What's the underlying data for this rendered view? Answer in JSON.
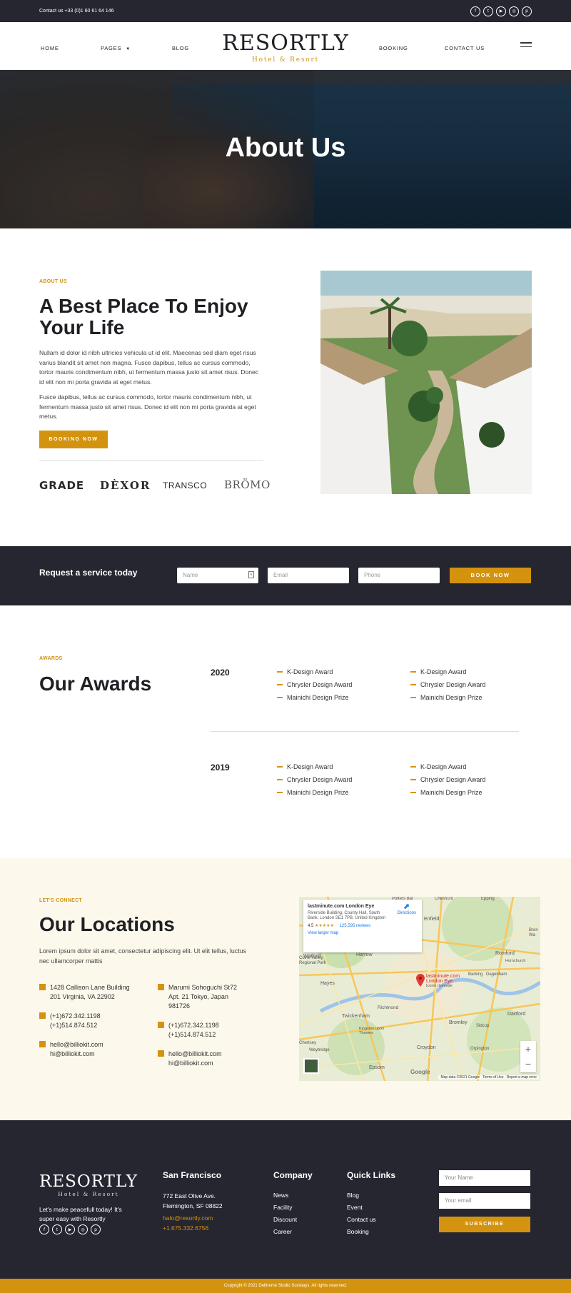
{
  "topbar": {
    "contact": "Contact us +33 (0)1 60 61 64 146",
    "social_icons": [
      "facebook-icon",
      "twitter-icon",
      "youtube-icon",
      "instagram-icon",
      "pinterest-icon"
    ]
  },
  "nav": {
    "home": "HOME",
    "pages": "PAGES",
    "blog": "BLOG",
    "booking": "BOOKING",
    "contact": "CONTACT US",
    "brand": "RESORTLY",
    "brand_sub": "Hotel & Resort"
  },
  "hero": {
    "title": "About Us"
  },
  "about": {
    "eyebrow": "ABOUT US",
    "title": "A Best Place To Enjoy Your Life",
    "para1": "Nullam id dolor id nibh ultricies vehicula ut id elit. Maecenas sed diam eget risus varius blandit sit amet non magna. Fusce dapibus, tellus ac cursus commodo, tortor mauris condimentum nibh, ut fermentum massa justo sit amet risus. Donec id elit non mi porta gravida at eget metus.",
    "para2": "Fusce dapibus, tellus ac cursus commodo, tortor mauris condimentum nibh, ut fermentum massa justo sit amet risus. Donec id elit non mi porta gravida at eget metus.",
    "button": "BOOKING NOW",
    "partners": [
      "GRADE",
      "DÈXOR",
      "TRANSCO",
      "BRÖMO"
    ]
  },
  "request": {
    "label": "Request a service today",
    "name_placeholder": "Name",
    "email_placeholder": "Email",
    "phone_placeholder": "Phone",
    "button": "BOOK NOW"
  },
  "awards": {
    "eyebrow": "AWARDS",
    "title": "Our Awards",
    "years": [
      {
        "year": "2020",
        "col1": [
          "K-Design Award",
          "Chrysler Design Award",
          "Mainichi Design Prize"
        ],
        "col2": [
          "K-Design Award",
          "Chrysler Design Award",
          "Mainichi Design Prize"
        ]
      },
      {
        "year": "2019",
        "col1": [
          "K-Design Award",
          "Chrysler Design Award",
          "Mainichi Design Prize"
        ],
        "col2": [
          "K-Design Award",
          "Chrysler Design Award",
          "Mainichi Design Prize"
        ]
      }
    ]
  },
  "locations": {
    "eyebrow": "LET'S CONNECT",
    "title": "Our Locations",
    "desc": "Lorem ipsum dolor sit amet, consectetur adipiscing elit. Ut elit tellus, luctus nec ullamcorper mattis",
    "left": {
      "address1": "1428 Callison Lane Building",
      "address2": "201 Virginia, VA 22902",
      "phone1": "(+1)672.342.1198",
      "phone2": "(+1)514.874.512",
      "email1": "hello@billiokit.com",
      "email2": "hi@billiokit.com"
    },
    "right": {
      "address1": "Marumi Sohoguchi St72",
      "address2": "Apt. 21 Tokyo, Japan",
      "address3": "981726",
      "phone1": "(+1)672.342.1198",
      "phone2": "(+1)514.874.512",
      "email1": "hello@billiokit.com",
      "email2": "hi@billiokit.com"
    }
  },
  "map": {
    "card_title": "lastminute.com London Eye",
    "card_address": "Riverside Building, County Hall, South Bank, London SE1 7PB, United Kingdom",
    "rating": "4.5",
    "stars": "★★★★★",
    "reviews": "125,595 reviews",
    "directions": "Directions",
    "larger": "View larger map",
    "pin_label": "lastminute.com London Eye",
    "pin_sub": "Iconic riverside",
    "places": [
      "Potters Bar",
      "Cheshunt",
      "Epping",
      "Enfield",
      "Watford",
      "Harrow",
      "Romford",
      "Hornchurch",
      "Colne Valley Regional Park",
      "Hayes",
      "Barking",
      "Dagenham",
      "Richmond",
      "Twickenham",
      "Kingston upon Thames",
      "Bromley",
      "Dartford",
      "Chertsey",
      "Weybridge",
      "Croydon",
      "Orpington",
      "Epsom",
      "Sidcup",
      "Bren Wa"
    ],
    "attribution": "Map data ©2021 Google",
    "terms": "Terms of Use",
    "report": "Report a map error",
    "google": "Google"
  },
  "footer": {
    "brand": "RESORTLY",
    "brand_sub": "Hotel & Resort",
    "tagline": "Let's make peacefull today! It's super easy with Resortly",
    "city": "San Francisco",
    "addr1": "772 East Olive Ave.",
    "addr2": "Flemington, SF 08822",
    "email": "halo@resortly.com",
    "phone": "+1.675.332.6756",
    "company_title": "Company",
    "company_links": [
      "News",
      "Facility",
      "Discount",
      "Career"
    ],
    "quick_title": "Quick Links",
    "quick_links": [
      "Blog",
      "Event",
      "Contact us",
      "Booking"
    ],
    "name_placeholder": "Your Name",
    "email_placeholder": "Your email",
    "subscribe": "SUBSCRIBE",
    "copyright": "Copyright © 2021 Deltheme Studio Sursbays. All rights reserved."
  },
  "colors": {
    "accent": "#d4930f",
    "dark": "#262630",
    "cream": "#fdf8ec"
  }
}
